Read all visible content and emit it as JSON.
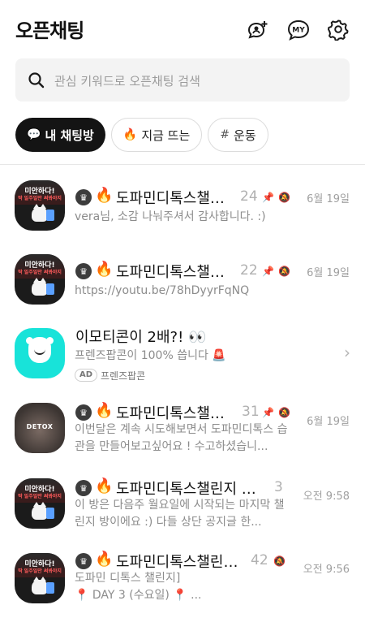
{
  "header": {
    "title": "오픈채팅",
    "icons": [
      "add-chat-icon",
      "my-profile-icon",
      "gear-icon"
    ],
    "my_label": "MY"
  },
  "search": {
    "placeholder": "관심 키워드로 오픈채팅 검색",
    "value": ""
  },
  "tabs": [
    {
      "label": "내 채팅방",
      "glyph": "💬",
      "active": true
    },
    {
      "label": "지금 뜨는",
      "glyph": "🔥",
      "active": false
    },
    {
      "label": "운동",
      "glyph": "#",
      "active": false
    }
  ],
  "thumbnail": {
    "poster_line1": "미안하다!",
    "poster_line2": "딱 일주일만 써봐야지",
    "detox_label": "DETOX"
  },
  "chats": [
    {
      "fire": "🔥",
      "title": "도파민디톡스챌…",
      "count": "24",
      "pinned": true,
      "muted": true,
      "time": "6월 19일",
      "message": "vera님, 소감 나눠주셔서 감사합니다. :)"
    },
    {
      "fire": "🔥",
      "title": "도파민디톡스챌…",
      "count": "22",
      "pinned": true,
      "muted": true,
      "time": "6월 19일",
      "message": "https://youtu.be/78hDyyrFqNQ"
    },
    {
      "title": "이모티콘이 2배?! 👀",
      "message": "프렌즈팝콘이 100% 씁니다 🚨",
      "ad_badge": "AD",
      "sponsor": "프렌즈팝콘"
    },
    {
      "fire": "🔥",
      "title": "도파민디톡스챌…",
      "count": "31",
      "pinned": true,
      "muted": true,
      "time": "6월 19일",
      "message": "이번달은 계속 시도해보면서 도파민디톡스 습관을 만들어보고싶어요 ! 수고하셨습니..."
    },
    {
      "fire": "🔥",
      "title": "도파민디톡스챌린지 #...",
      "count": "3",
      "pinned": false,
      "muted": false,
      "time": "오전 9:58",
      "message": "이 방은 다음주 월요일에 시작되는 마지막 챌린지 방이에요 :) 다들 상단 공지글 한..."
    },
    {
      "fire": "🔥",
      "title": "도파민디톡스챌린…",
      "count": "42",
      "pinned": false,
      "muted": true,
      "time": "오전 9:56",
      "message": "도파민 디톡스 챌린지]\n📍 DAY 3 (수요일) 📍 ..."
    }
  ]
}
